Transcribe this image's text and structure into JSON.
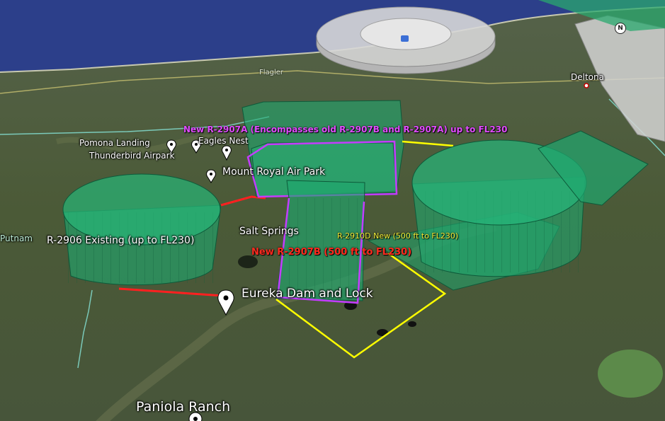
{
  "labels": {
    "flagler": "Flagler",
    "deltona": "Deltona",
    "pomona_landing": "Pomona Landing",
    "thunderbird_airpark": "Thunderbird Airpark",
    "eagles_nest": "Eagles Nest",
    "mount_royal_air_park": "Mount Royal Air Park",
    "salt_springs": "Salt Springs",
    "putnam": "Putnam",
    "eureka_dam": "Eureka Dam and Lock",
    "paniola_ranch": "Paniola Ranch"
  },
  "airspace": {
    "r2907a": "New R-2907A (Encompasses old R-2907B and R-2907A) up to FL230",
    "r2906": "R-2906 Existing (up to FL230)",
    "r2910d": "R-2910D New (500 ft to FL230)",
    "r2907b": "New R-2907B (500 ft to FL230)"
  },
  "compass": "N",
  "colors": {
    "volume_fill": "#1fa86f",
    "volume_stroke": "#0d5a3a",
    "r2907a_outline": "#c43cff",
    "r2906_outline": "#ff2020",
    "r2910d_outline": "#ffff00",
    "ocean": "#2c3f8a",
    "land": "#4d5d3a"
  }
}
